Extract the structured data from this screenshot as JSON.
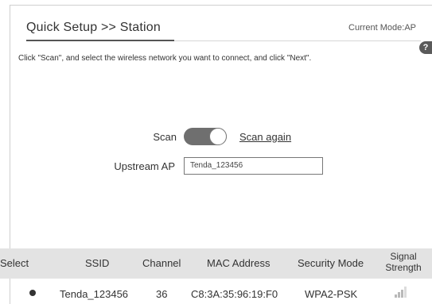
{
  "header": {
    "title": "Quick Setup >> Station",
    "current_mode": "Current Mode:AP",
    "help_label": "?"
  },
  "instructions": "Click \"Scan\", and select the wireless network you want to connect, and click \"Next\".",
  "scan": {
    "label": "Scan",
    "toggle_on": true,
    "scan_again_label": "Scan again"
  },
  "upstream": {
    "label": "Upstream AP",
    "value": "Tenda_123456"
  },
  "table": {
    "headers": {
      "select": "Select",
      "ssid": "SSID",
      "channel": "Channel",
      "mac": "MAC Address",
      "security": "Security Mode",
      "signal_line1": "Signal",
      "signal_line2": "Strength"
    },
    "rows": [
      {
        "selected": true,
        "ssid": "Tenda_123456",
        "channel": "36",
        "mac": "C8:3A:35:96:19:F0",
        "security": "WPA2-PSK",
        "signal_icon": "signal-strength-icon",
        "signal_level": 0.75
      }
    ]
  },
  "colors": {
    "toggle_on": "#6f6f6f",
    "header_bg": "#e3e3e3"
  }
}
